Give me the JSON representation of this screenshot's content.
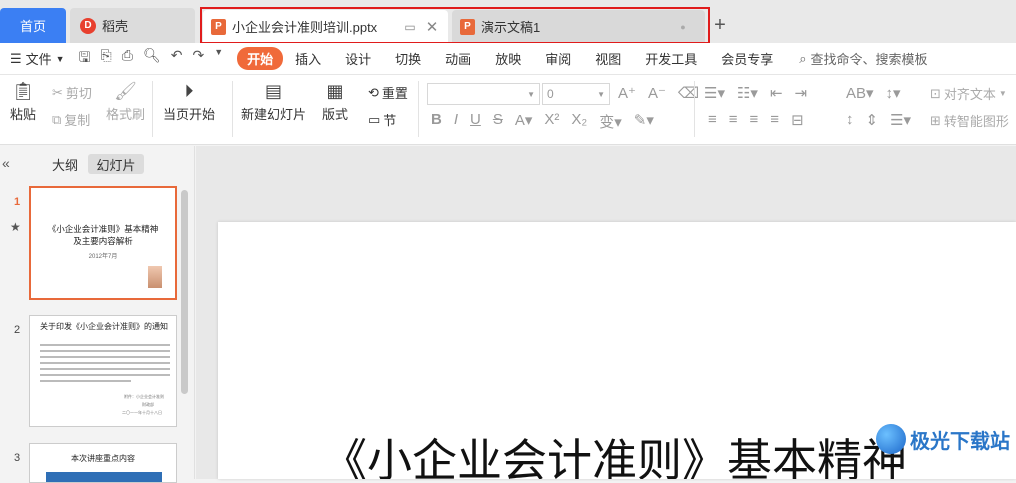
{
  "tabs": {
    "home": "首页",
    "daoke": "稻壳",
    "active_doc": "小企业会计准则培训.pptx",
    "other_doc": "演示文稿1",
    "new_tab": "+"
  },
  "menubar": {
    "file": "文件",
    "items": [
      "开始",
      "插入",
      "设计",
      "切换",
      "动画",
      "放映",
      "审阅",
      "视图",
      "开发工具",
      "会员专享"
    ],
    "search": "查找命令、搜索模板"
  },
  "ribbon": {
    "paste": "粘贴",
    "cut": "剪切",
    "copy": "复制",
    "format_painter": "格式刷",
    "from_current": "当页开始",
    "new_slide": "新建幻灯片",
    "layout": "版式",
    "reset": "重置",
    "section": "节",
    "font_size": "0",
    "align_text": "对齐文本",
    "smartart": "转智能图形"
  },
  "pane": {
    "outline": "大纲",
    "slides": "幻灯片"
  },
  "slides": [
    {
      "num": "1",
      "title_line1": "《小企业会计准则》基本精神",
      "title_line2": "及主要内容解析",
      "date": "2012年7月"
    },
    {
      "num": "2",
      "title": "关于印发《小企业会计准则》的通知",
      "sign1": "附件：小企业会计准则",
      "sign2": "财政部",
      "sign3": "二〇一一年十月十八日"
    },
    {
      "num": "3",
      "title": "本次讲座重点内容"
    }
  ],
  "slide_title": "《小企业会计准则》基本精神",
  "watermark": "极光下载站",
  "colors": {
    "accent": "#f06a3a",
    "home_tab": "#3b7ff3",
    "highlight": "#e01c1c"
  }
}
